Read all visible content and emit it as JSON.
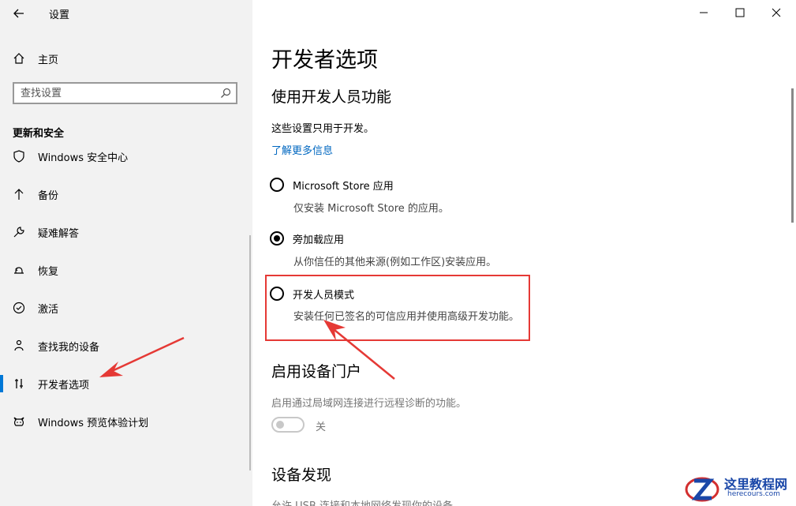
{
  "window": {
    "title": "设置",
    "minimize_label": "minimize",
    "maximize_label": "maximize",
    "close_label": "close"
  },
  "sidebar": {
    "home_label": "主页",
    "search_placeholder": "查找设置",
    "section_heading": "更新和安全",
    "items": [
      {
        "label": "Windows 安全中心",
        "icon": "shield-icon"
      },
      {
        "label": "备份",
        "icon": "backup-arrow-icon"
      },
      {
        "label": "疑难解答",
        "icon": "wrench-icon"
      },
      {
        "label": "恢复",
        "icon": "recovery-icon"
      },
      {
        "label": "激活",
        "icon": "check-circle-icon"
      },
      {
        "label": "查找我的设备",
        "icon": "person-location-icon"
      },
      {
        "label": "开发者选项",
        "icon": "developer-tools-icon",
        "selected": true
      },
      {
        "label": "Windows 预览体验计划",
        "icon": "insider-cat-icon"
      }
    ]
  },
  "main": {
    "page_title": "开发者选项",
    "section1_title": "使用开发人员功能",
    "section1_desc": "这些设置只用于开发。",
    "learn_more_link": "了解更多信息",
    "options": [
      {
        "label": "Microsoft Store 应用",
        "desc": "仅安装 Microsoft Store 的应用。",
        "checked": false
      },
      {
        "label": "旁加载应用",
        "desc": "从你信任的其他来源(例如工作区)安装应用。",
        "checked": true
      },
      {
        "label": "开发人员模式",
        "desc": "安装任何已签名的可信应用并使用高级开发功能。",
        "checked": false
      }
    ],
    "section2_title": "启用设备门户",
    "section2_desc": "启用通过局域网连接进行远程诊断的功能。",
    "toggle_state": "关",
    "section3_title": "设备发现",
    "section3_desc": "允许 USB 连接和本地网络发现你的设备。"
  },
  "watermark": {
    "title": "这里教程网",
    "subtitle": "herecours.com"
  },
  "colors": {
    "accent": "#0078d7",
    "link": "#0067c0",
    "annotation_red": "#e53935"
  }
}
